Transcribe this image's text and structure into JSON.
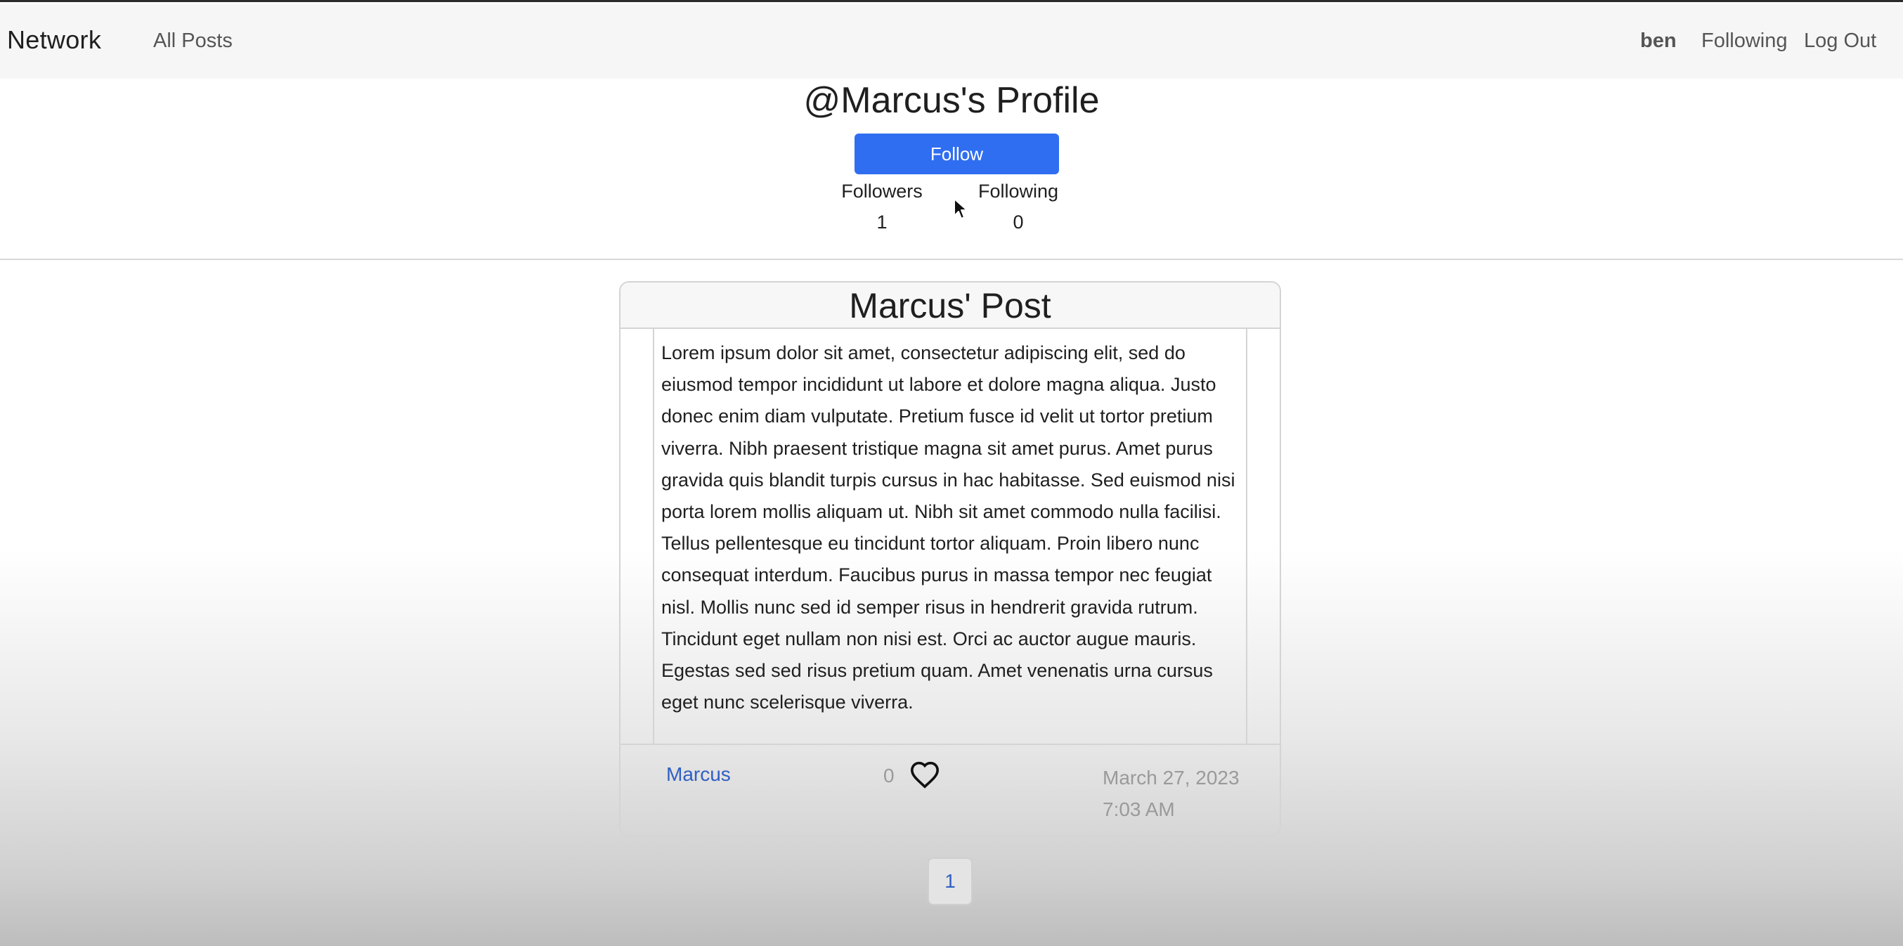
{
  "navbar": {
    "brand": "Network",
    "all_posts": "All Posts",
    "username": "ben",
    "following": "Following",
    "logout": "Log Out"
  },
  "profile": {
    "title": "@Marcus's Profile",
    "follow_button": "Follow",
    "followers_label": "Followers",
    "followers_count": "1",
    "following_label": "Following",
    "following_count": "0"
  },
  "post": {
    "title": "Marcus' Post",
    "lines": [
      "Lorem ipsum dolor sit amet, consectetur adipiscing elit, sed do",
      "eiusmod tempor incididunt ut labore et dolore magna aliqua. Justo",
      "donec enim diam vulputate. Pretium fusce id velit ut tortor pretium",
      "viverra. Nibh praesent tristique magna sit amet purus. Amet purus",
      "gravida quis blandit turpis cursus in hac habitasse. Sed euismod nisi",
      "porta lorem mollis aliquam ut. Nibh sit amet commodo nulla facilisi.",
      "Tellus pellentesque eu tincidunt tortor aliquam. Proin libero nunc",
      "consequat interdum. Faucibus purus in massa tempor nec feugiat",
      "nisl. Mollis nunc sed id semper risus in hendrerit gravida rutrum.",
      "Tincidunt eget nullam non nisi est. Orci ac auctor augue mauris.",
      "Egestas sed sed risus pretium quam. Amet venenatis urna cursus",
      "eget nunc scelerisque viverra."
    ],
    "author": "Marcus",
    "likes": "0",
    "like_icon": "heart-outline-icon",
    "date_line1": "March 27, 2023",
    "date_line2": "7:03 AM"
  },
  "pagination": {
    "current_page": "1"
  },
  "colors": {
    "accent": "#2f6ef0",
    "link": "#2f5fc4",
    "muted": "#9a9a9a"
  }
}
